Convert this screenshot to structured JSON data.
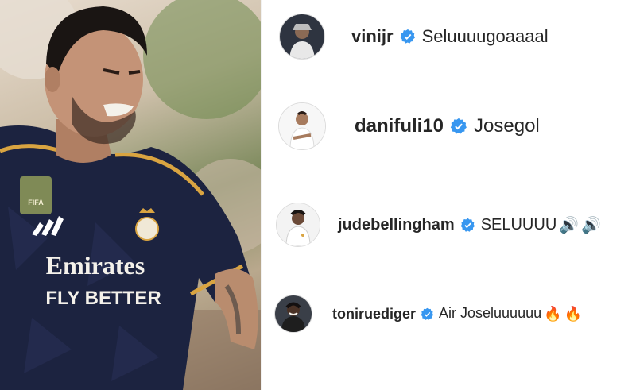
{
  "photo": {
    "sponsor_line1": "Emirates",
    "sponsor_line2": "FLY BETTER",
    "badge_text": "FIFA"
  },
  "colors": {
    "verified": "#3897f0",
    "text": "#262626",
    "kit_navy": "#1c2340",
    "kit_gold": "#d9a441"
  },
  "comments": [
    {
      "username": "vinijr",
      "verified": true,
      "text": "Seluuuugoaaaal",
      "emoji": [],
      "avatar_icon": "player-avatar-icon"
    },
    {
      "username": "danifuli10",
      "verified": true,
      "text": "Josegol",
      "emoji": [],
      "avatar_icon": "player-avatar-icon"
    },
    {
      "username": "judebellingham",
      "verified": true,
      "text": "SELUUUU",
      "emoji": [
        "🔊",
        "🔊"
      ],
      "avatar_icon": "player-avatar-icon"
    },
    {
      "username": "toniruediger",
      "verified": true,
      "text": "Air Joseluuuuuu",
      "emoji": [
        "🔥",
        "🔥"
      ],
      "avatar_icon": "player-avatar-icon"
    }
  ]
}
